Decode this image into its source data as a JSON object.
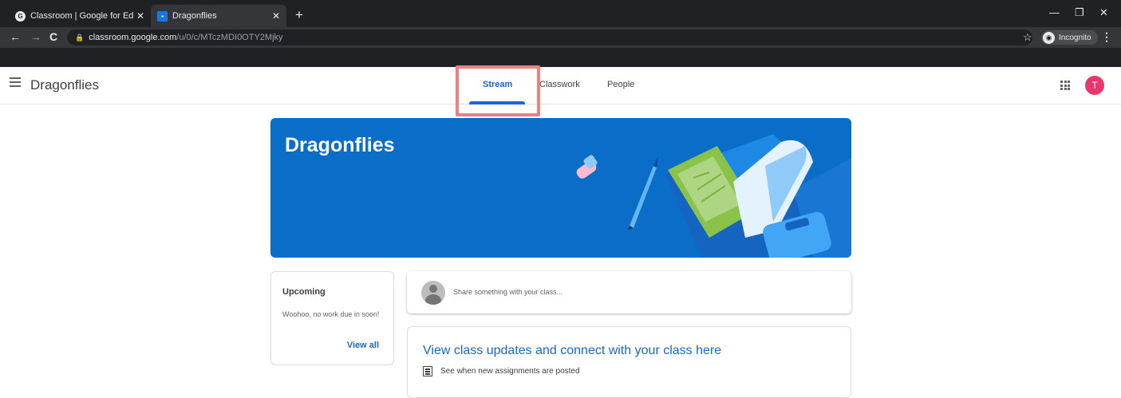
{
  "browser": {
    "tabs": [
      {
        "title": "Classroom | Google for Education",
        "favicon": "google-icon",
        "active": false
      },
      {
        "title": "Dragonflies",
        "favicon": "classroom-icon",
        "active": true
      }
    ],
    "url_host": "classroom.google.com",
    "url_path": "/u/0/c/MTczMDI0OTY2Mjky",
    "incognito_label": "Incognito"
  },
  "header": {
    "class_name": "Dragonflies",
    "tabs": [
      {
        "label": "Stream",
        "active": true
      },
      {
        "label": "Classwork",
        "active": false
      },
      {
        "label": "People",
        "active": false
      }
    ],
    "avatar_initial": "T",
    "avatar_color": "#e8386b",
    "highlight_color": "#f08080"
  },
  "banner": {
    "title": "Dragonflies",
    "color": "#0a6ec9"
  },
  "upcoming": {
    "title": "Upcoming",
    "text": "Woohoo, no work due in soon!",
    "link": "View all"
  },
  "share": {
    "placeholder": "Share something with your class..."
  },
  "updates": {
    "title": "View class updates and connect with your class here",
    "row_text": "See when new assignments are posted"
  },
  "accent_color": "#1967d2"
}
